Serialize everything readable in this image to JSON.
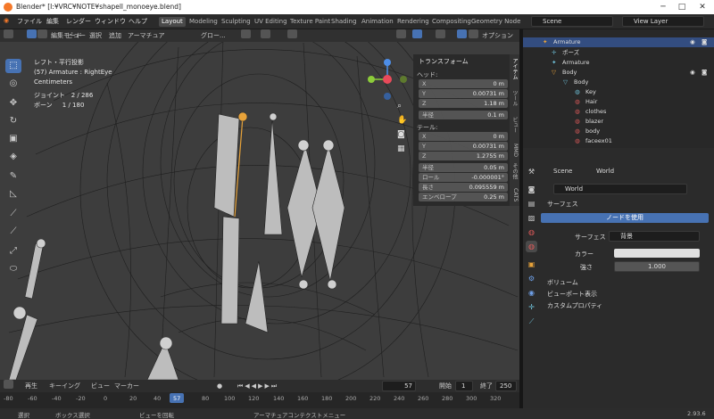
{
  "title": "Blender* [I:¥VRC¥NOTE¥shapell_monoeye.blend]",
  "menu": [
    "ファイル",
    "編集",
    "レンダー",
    "ウィンドウ",
    "ヘルプ"
  ],
  "workspaces": [
    "Layout",
    "Modeling",
    "Sculpting",
    "UV Editing",
    "Texture Paint",
    "Shading",
    "Animation",
    "Rendering",
    "Compositing",
    "Geometry Node"
  ],
  "scene": "Scene",
  "view_layer": "View Layer",
  "viewport": {
    "mode": "編集モード",
    "menus": [
      "ビュー",
      "選択",
      "追加",
      "アーマチュア"
    ],
    "orient": "グロー...",
    "options": "オプション"
  },
  "info": {
    "view": "レフト・平行投影",
    "object": "(57) Armature : RightEye",
    "units": "Centimeters",
    "joints_label": "ジョイント",
    "joints": "2 / 286",
    "bones_label": "ボーン",
    "bones": "1 / 180"
  },
  "npanel": {
    "title": "トランスフォーム",
    "head": "ヘッド:",
    "head_x": "0 m",
    "head_y": "0.00731 m",
    "head_z": "1.18 m",
    "radius_label": "半径",
    "head_radius": "0.1 m",
    "tail": "テール:",
    "tail_x": "0 m",
    "tail_y": "0.00731 m",
    "tail_z": "1.2755 m",
    "tail_radius": "0.05 m",
    "roll_label": "ロール",
    "roll": "-0.000001°",
    "length_label": "長さ",
    "length": "0.095559 m",
    "envelope_label": "エンベロープ",
    "envelope": "0.25 m",
    "tabs": [
      "アイテム",
      "ツール",
      "ビュー",
      "MMD",
      "その他",
      "CATS"
    ]
  },
  "timeline": {
    "menus": [
      "再生",
      "キーイング",
      "ビュー",
      "マーカー"
    ],
    "frame": "57",
    "start_label": "開始",
    "start": "1",
    "end_label": "終了",
    "end": "250",
    "ticks": [
      "-80",
      "-60",
      "-40",
      "-20",
      "0",
      "20",
      "40",
      "57",
      "80",
      "100",
      "120",
      "140",
      "160",
      "180",
      "200",
      "220",
      "240",
      "260",
      "280",
      "300",
      "320"
    ]
  },
  "status": {
    "select": "選択",
    "box": "ボックス選択",
    "rotate": "ビューを回転",
    "context": "アーマチュアコンテクストメニュー",
    "version": "2.93.6"
  },
  "outliner": [
    {
      "label": "Armature",
      "indent": 1,
      "sel": true
    },
    {
      "label": "ポーズ",
      "indent": 2
    },
    {
      "label": "Armature",
      "indent": 2
    },
    {
      "label": "Body",
      "indent": 1
    },
    {
      "label": "Body",
      "indent": 2
    },
    {
      "label": "Key",
      "indent": 3
    },
    {
      "label": "Hair",
      "indent": 3
    },
    {
      "label": "clothes",
      "indent": 3
    },
    {
      "label": "blazer",
      "indent": 3
    },
    {
      "label": "body",
      "indent": 3
    },
    {
      "label": "faceex01",
      "indent": 3
    }
  ],
  "props": {
    "scene": "Scene",
    "world_crumb": "World",
    "world": "World",
    "surface_panel": "サーフェス",
    "use_nodes": "ノードを使用",
    "surface_label": "サーフェス",
    "surface_value": "背景",
    "color_label": "カラー",
    "strength_label": "強さ",
    "strength": "1.000",
    "volume": "ボリューム",
    "viewport_display": "ビューポート表示",
    "custom_props": "カスタムプロパティ"
  },
  "colors": {
    "accent": "#4772b3",
    "header": "#303030",
    "active_bone": "#e8a33a"
  }
}
